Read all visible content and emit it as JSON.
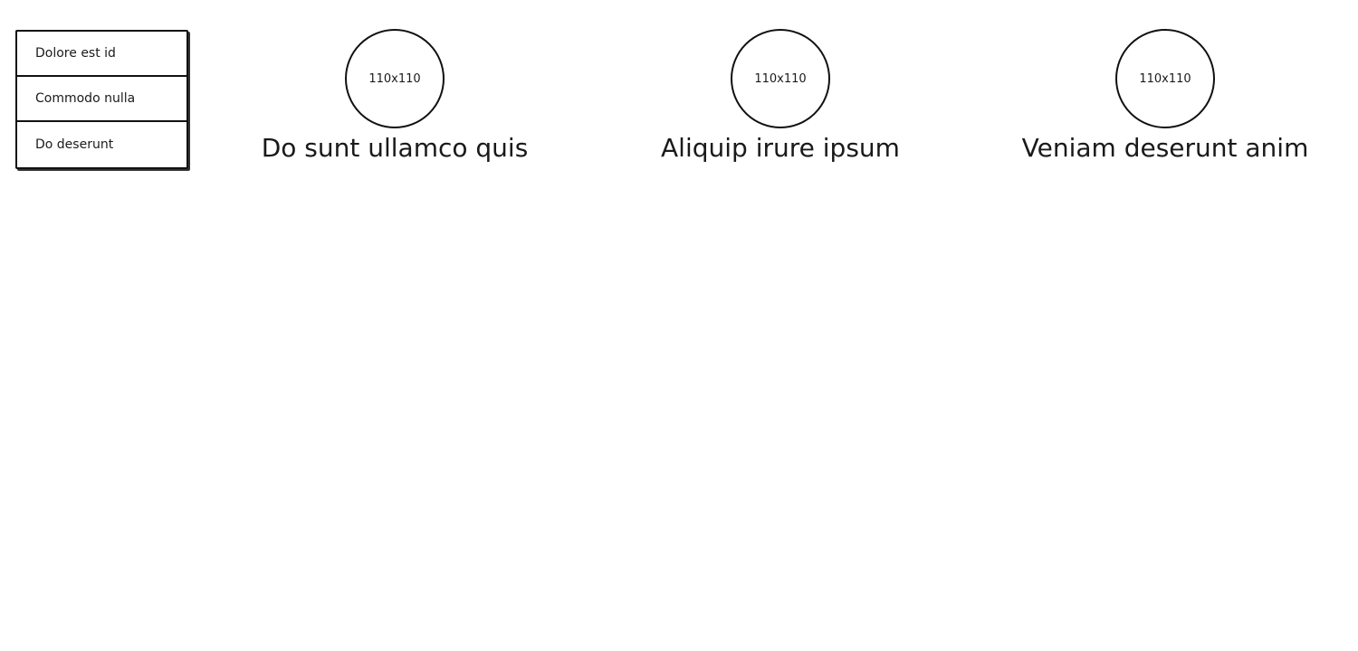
{
  "menu": {
    "items": [
      {
        "label": "Dolore est id"
      },
      {
        "label": "Commodo nulla"
      },
      {
        "label": "Do deserunt"
      }
    ]
  },
  "cards": [
    {
      "image_label": "110x110",
      "title": "Do sunt ullamco quis"
    },
    {
      "image_label": "110x110",
      "title": "Aliquip irure ipsum"
    },
    {
      "image_label": "110x110",
      "title": "Veniam deserunt anim"
    }
  ]
}
